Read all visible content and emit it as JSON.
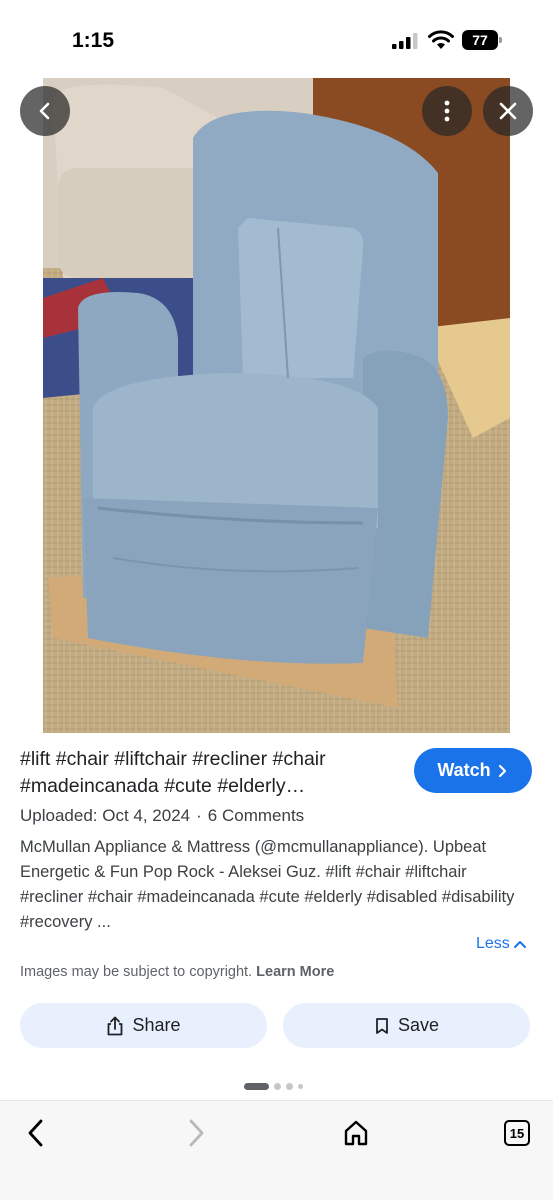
{
  "status_bar": {
    "time": "1:15",
    "battery": "77"
  },
  "result": {
    "title": "#lift #chair #liftchair #recliner #chair #madeincanada #cute #elderly…",
    "watch_label": "Watch",
    "uploaded": "Uploaded: Oct 4, 2024",
    "separator": "·",
    "comments": "6 Comments",
    "description": "McMullan Appliance & Mattress (@mcmullanappliance). Upbeat Energetic & Fun Pop Rock - Aleksei Guz. #lift #chair #liftchair #recliner #chair #madeincanada #cute #elderly #disabled #disability #recovery ...",
    "less_label": "Less",
    "copyright_text": "Images may be subject to copyright.",
    "learn_more": "Learn More",
    "share_label": "Share",
    "save_label": "Save"
  },
  "toolbar": {
    "tab_count": "15"
  },
  "colors": {
    "accent": "#1a73e8",
    "action_bg": "#e8f0fe"
  },
  "icons": [
    "back-arrow-icon",
    "more-vert-icon",
    "close-icon",
    "chevron-right-icon",
    "chevron-up-icon",
    "share-icon",
    "bookmark-icon",
    "home-icon",
    "tabs-icon"
  ]
}
